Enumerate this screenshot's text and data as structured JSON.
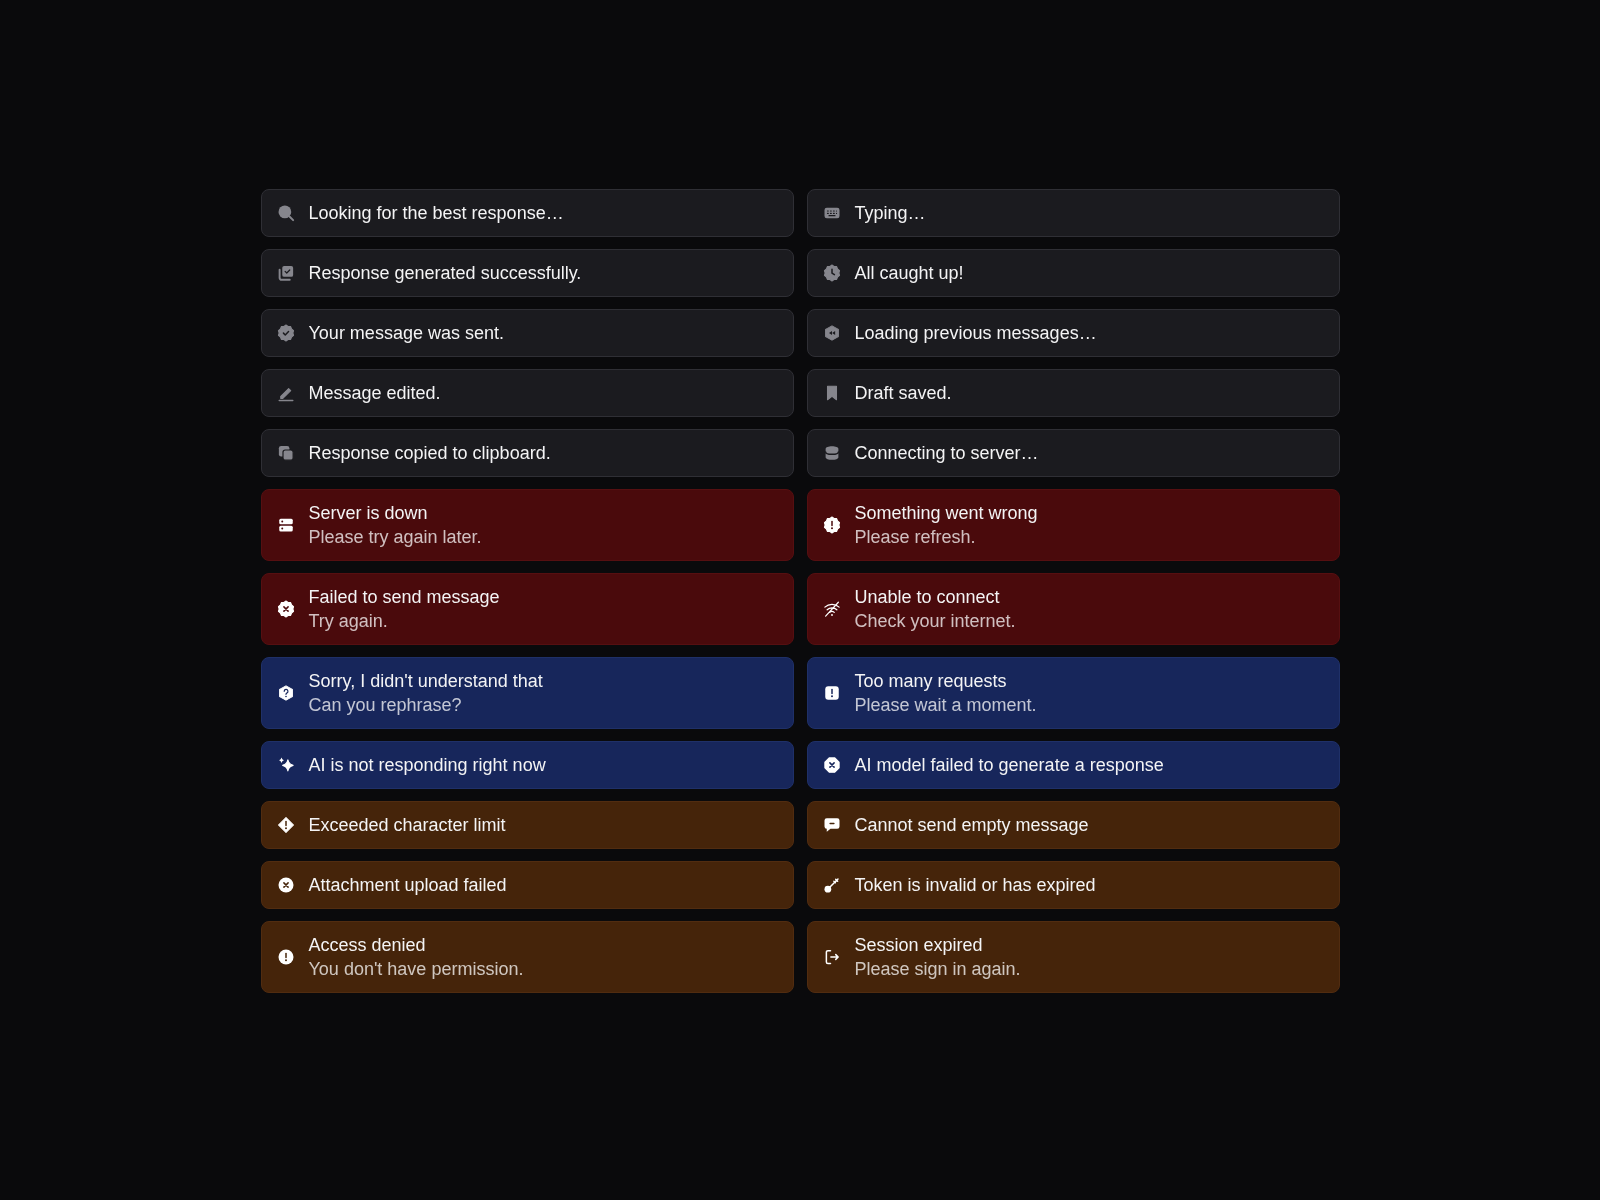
{
  "toasts": [
    {
      "kind": "neutral",
      "title": "Looking for the best response…"
    },
    {
      "kind": "neutral",
      "title": "Typing…"
    },
    {
      "kind": "neutral",
      "title": "Response generated successfully."
    },
    {
      "kind": "neutral",
      "title": "All caught up!"
    },
    {
      "kind": "neutral",
      "title": "Your message was sent."
    },
    {
      "kind": "neutral",
      "title": "Loading previous messages…"
    },
    {
      "kind": "neutral",
      "title": "Message edited."
    },
    {
      "kind": "neutral",
      "title": "Draft saved."
    },
    {
      "kind": "neutral",
      "title": "Response copied to clipboard."
    },
    {
      "kind": "neutral",
      "title": "Connecting to server…"
    },
    {
      "kind": "error",
      "title": "Server is down",
      "message": "Please try again later."
    },
    {
      "kind": "error",
      "title": "Something went wrong",
      "message": "Please refresh."
    },
    {
      "kind": "error",
      "title": "Failed to send message",
      "message": "Try again."
    },
    {
      "kind": "error",
      "title": "Unable to connect",
      "message": "Check your internet."
    },
    {
      "kind": "info",
      "title": "Sorry, I didn't understand that",
      "message": "Can you rephrase?"
    },
    {
      "kind": "info",
      "title": "Too many requests",
      "message": "Please wait a moment."
    },
    {
      "kind": "info",
      "title": "AI is not responding right now"
    },
    {
      "kind": "info",
      "title": "AI model failed to generate a response"
    },
    {
      "kind": "warning",
      "title": "Exceeded character limit"
    },
    {
      "kind": "warning",
      "title": "Cannot send empty message"
    },
    {
      "kind": "warning",
      "title": "Attachment upload failed"
    },
    {
      "kind": "warning",
      "title": "Token is invalid or has expired"
    },
    {
      "kind": "warning",
      "title": "Access denied",
      "message": "You don't have permission."
    },
    {
      "kind": "warning",
      "title": "Session expired",
      "message": "Please sign in again."
    }
  ]
}
